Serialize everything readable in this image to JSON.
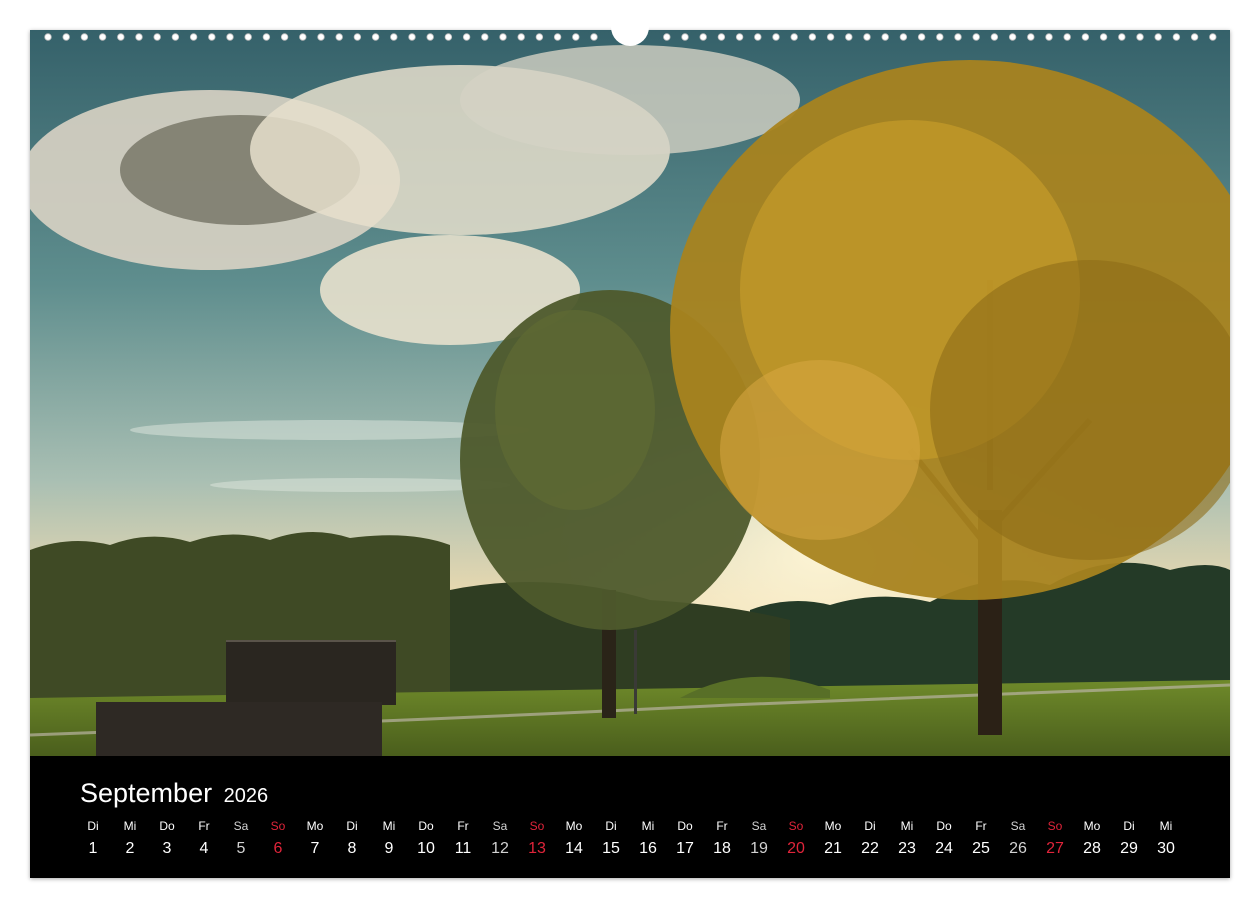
{
  "calendar": {
    "month": "September",
    "year": "2026",
    "days": [
      {
        "weekday": "Di",
        "day": "1",
        "type": "weekday"
      },
      {
        "weekday": "Mi",
        "day": "2",
        "type": "weekday"
      },
      {
        "weekday": "Do",
        "day": "3",
        "type": "weekday"
      },
      {
        "weekday": "Fr",
        "day": "4",
        "type": "weekday"
      },
      {
        "weekday": "Sa",
        "day": "5",
        "type": "saturday"
      },
      {
        "weekday": "So",
        "day": "6",
        "type": "sunday"
      },
      {
        "weekday": "Mo",
        "day": "7",
        "type": "weekday"
      },
      {
        "weekday": "Di",
        "day": "8",
        "type": "weekday"
      },
      {
        "weekday": "Mi",
        "day": "9",
        "type": "weekday"
      },
      {
        "weekday": "Do",
        "day": "10",
        "type": "weekday"
      },
      {
        "weekday": "Fr",
        "day": "11",
        "type": "weekday"
      },
      {
        "weekday": "Sa",
        "day": "12",
        "type": "saturday"
      },
      {
        "weekday": "So",
        "day": "13",
        "type": "sunday"
      },
      {
        "weekday": "Mo",
        "day": "14",
        "type": "weekday"
      },
      {
        "weekday": "Di",
        "day": "15",
        "type": "weekday"
      },
      {
        "weekday": "Mi",
        "day": "16",
        "type": "weekday"
      },
      {
        "weekday": "Do",
        "day": "17",
        "type": "weekday"
      },
      {
        "weekday": "Fr",
        "day": "18",
        "type": "weekday"
      },
      {
        "weekday": "Sa",
        "day": "19",
        "type": "saturday"
      },
      {
        "weekday": "So",
        "day": "20",
        "type": "sunday"
      },
      {
        "weekday": "Mo",
        "day": "21",
        "type": "weekday"
      },
      {
        "weekday": "Di",
        "day": "22",
        "type": "weekday"
      },
      {
        "weekday": "Mi",
        "day": "23",
        "type": "weekday"
      },
      {
        "weekday": "Do",
        "day": "24",
        "type": "weekday"
      },
      {
        "weekday": "Fr",
        "day": "25",
        "type": "weekday"
      },
      {
        "weekday": "Sa",
        "day": "26",
        "type": "saturday"
      },
      {
        "weekday": "So",
        "day": "27",
        "type": "sunday"
      },
      {
        "weekday": "Mo",
        "day": "28",
        "type": "weekday"
      },
      {
        "weekday": "Di",
        "day": "29",
        "type": "weekday"
      },
      {
        "weekday": "Mi",
        "day": "30",
        "type": "weekday"
      }
    ]
  },
  "colors": {
    "sunday": "#e0243a",
    "saturday": "#d2d2d2",
    "strip": "#000000"
  },
  "icons": [
    "spiral-binding-icon",
    "hanger-notch-icon"
  ]
}
